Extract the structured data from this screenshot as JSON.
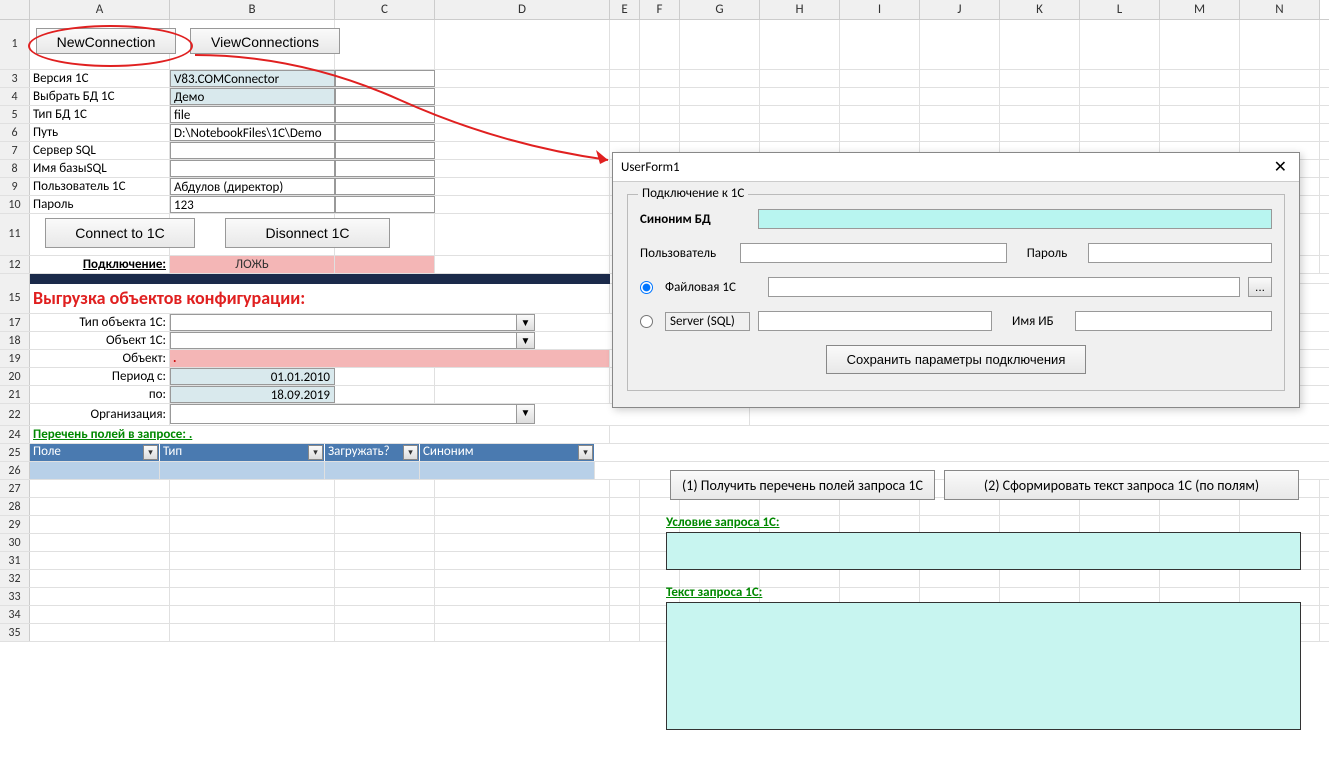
{
  "columns": [
    "A",
    "B",
    "C",
    "D",
    "E",
    "F",
    "G",
    "H",
    "I",
    "J",
    "K",
    "L",
    "M",
    "N"
  ],
  "buttons": {
    "new_connection": "NewConnection",
    "view_connections": "ViewConnections",
    "connect_1c": "Connect to 1C",
    "disconnect_1c": "Disonnect 1C",
    "get_fields": "(1) Получить перечень полей запроса 1С",
    "form_query_text": "(2) Сформировать текст запроса 1С (по полям)"
  },
  "labels": {
    "version_1c": "Версия 1С",
    "select_db": "Выбрать БД 1С",
    "db_type": "Тип БД 1С",
    "path": "Путь",
    "sql_server": "Сервер SQL",
    "sql_db_name": "Имя базыSQL",
    "user_1c": "Пользователь 1С",
    "password": "Пароль",
    "connection": "Подключение:",
    "status_false": "ЛОЖЬ",
    "export_heading": "Выгрузка объектов конфигурации:",
    "object_type": "Тип объекта 1С:",
    "object_1c": "Объект 1С:",
    "object": "Объект:",
    "object_dot": ".",
    "period_from": "Период с:",
    "period_to": "по:",
    "organization": "Организация:",
    "fields_list": "Перечень полей в запросе: .",
    "query_condition": "Условие запроса 1С:",
    "query_text": "Текст запроса 1С:"
  },
  "values": {
    "version_1c": "V83.COMConnector",
    "select_db": "Демо",
    "db_type": "file",
    "path": "D:\\NotebookFiles\\1C\\Demo",
    "sql_server": "",
    "sql_db_name": "",
    "user_1c": "Абдулов (директор)",
    "password": "123",
    "period_from": "01.01.2010",
    "period_to": "18.09.2019"
  },
  "table_headers": {
    "field": "Поле",
    "type": "Тип",
    "load": "Загружать?",
    "synonym": "Синоним"
  },
  "dialog": {
    "title": "UserForm1",
    "fieldset_legend": "Подключение к 1С",
    "synonym_db": "Синоним БД",
    "user": "Пользователь",
    "password": "Пароль",
    "file_1c": "Файловая 1С",
    "server_sql": "Server (SQL)",
    "ib_name": "Имя ИБ",
    "browse": "...",
    "save_params": "Сохранить параметры подключения"
  }
}
